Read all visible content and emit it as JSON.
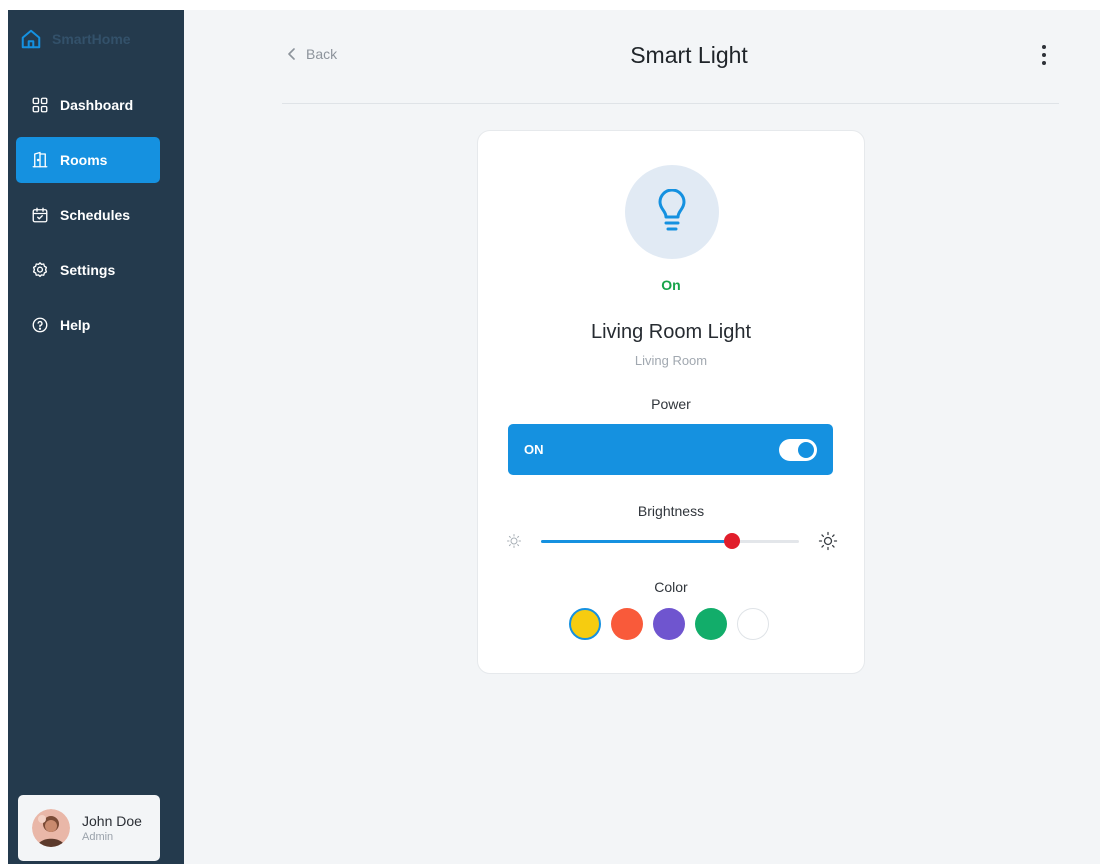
{
  "app": {
    "brand_name": "SmartHome"
  },
  "sidebar": {
    "items": [
      {
        "label": "Dashboard",
        "icon": "dashboard-icon"
      },
      {
        "label": "Rooms",
        "icon": "door-icon",
        "active": true
      },
      {
        "label": "Schedules",
        "icon": "calendar-icon"
      },
      {
        "label": "Settings",
        "icon": "gear-icon"
      },
      {
        "label": "Help",
        "icon": "help-icon"
      }
    ],
    "user": {
      "name": "John Doe",
      "role": "Admin"
    }
  },
  "header": {
    "back_label": "Back",
    "title": "Smart Light",
    "menu_icon": "more-vertical-icon"
  },
  "device": {
    "state_text": "On",
    "name": "Living Room Light",
    "room": "Living Room",
    "power_label": "Power",
    "power_state": "ON",
    "power_on": true,
    "brightness_label": "Brightness",
    "brightness": 0.74,
    "color_label": "Color",
    "colors": [
      "#f6cc10",
      "#f95a3a",
      "#6f55cf",
      "#12ad6a",
      "#ffffff"
    ],
    "selected_color": "#f6cc10"
  },
  "colors": {
    "accent": "#1591e0",
    "sidebar_bg": "#243a4d",
    "on_green": "#17a34a",
    "slider_thumb": "#e11d2b"
  }
}
